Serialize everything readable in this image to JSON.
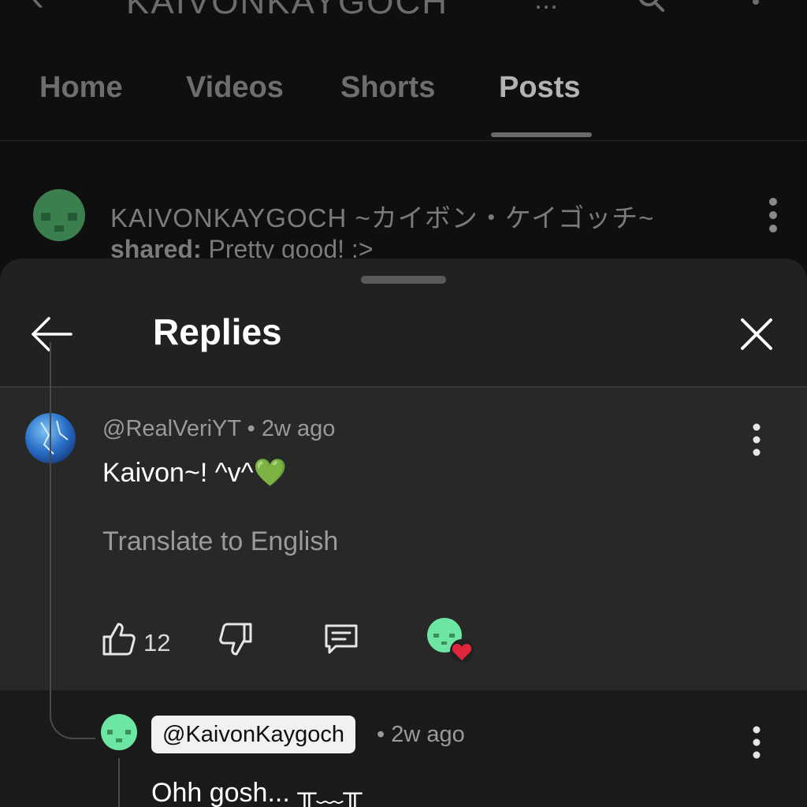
{
  "header": {
    "back_icon": "arrow-left-icon",
    "channel_title": "KAIVONKAYGOCH",
    "title_more": "...",
    "search_icon": "search-icon",
    "menu_icon": "more-vert-icon"
  },
  "tabs": [
    {
      "label": "Home",
      "active": false
    },
    {
      "label": "Videos",
      "active": false
    },
    {
      "label": "Shorts",
      "active": false
    },
    {
      "label": "Posts",
      "active": true
    }
  ],
  "post": {
    "author_line": "KAIVONKAYGOCH ~カイボン・ケイゴッチ~",
    "shared_label": "shared:",
    "shared_text": " Pretty good! :>"
  },
  "sheet": {
    "title": "Replies",
    "back_icon": "arrow-left-icon",
    "close_icon": "close-icon"
  },
  "comment": {
    "author": "@RealVeriYT",
    "separator": " • ",
    "time": "2w ago",
    "text": "Kaivon~! ^v^",
    "emoji": "💚",
    "translate_label": "Translate to English",
    "like_count": "12",
    "hearted": true
  },
  "reply": {
    "author": "@KaivonKaygoch",
    "time": "• 2w ago",
    "text": "Ohh gosh... ╥﹏╥"
  },
  "colors": {
    "background": "#0f0f0f",
    "sheet": "#212121",
    "highlighted_comment": "#282828",
    "heart": "#e0263a",
    "avatar_green": "#6de6a4"
  }
}
